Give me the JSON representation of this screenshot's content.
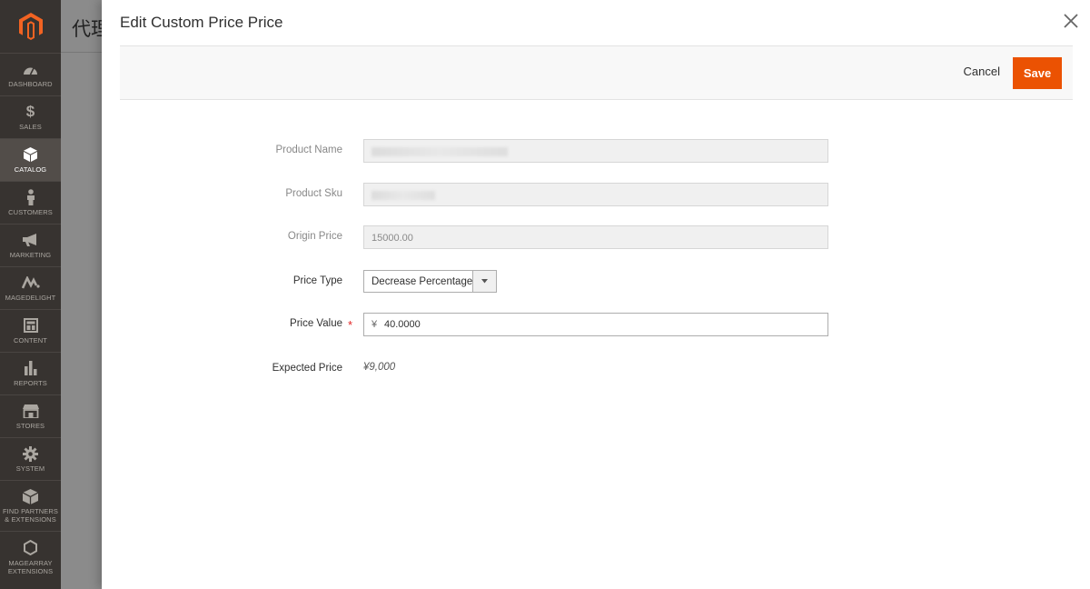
{
  "sidebar": {
    "items": [
      {
        "label": "DASHBOARD",
        "icon": "dashboard-icon"
      },
      {
        "label": "SALES",
        "icon": "dollar-icon"
      },
      {
        "label": "CATALOG",
        "icon": "box-icon",
        "active": true
      },
      {
        "label": "CUSTOMERS",
        "icon": "person-icon"
      },
      {
        "label": "MARKETING",
        "icon": "megaphone-icon"
      },
      {
        "label": "MAGEDELIGHT",
        "icon": "magedelight-icon"
      },
      {
        "label": "CONTENT",
        "icon": "layout-icon"
      },
      {
        "label": "REPORTS",
        "icon": "bar-chart-icon"
      },
      {
        "label": "STORES",
        "icon": "store-icon"
      },
      {
        "label": "SYSTEM",
        "icon": "gear-icon"
      },
      {
        "label": "FIND PARTNERS & EXTENSIONS",
        "icon": "cube-icon"
      },
      {
        "label": "MAGEARRAY EXTENSIONS",
        "icon": "hexagon-icon"
      }
    ]
  },
  "background": {
    "title": "代理"
  },
  "modal": {
    "title": "Edit Custom Price Price",
    "cancel_label": "Cancel",
    "save_label": "Save"
  },
  "form": {
    "product_name_label": "Product Name",
    "product_sku_label": "Product Sku",
    "origin_price_label": "Origin Price",
    "origin_price_value": "15000.00",
    "price_type_label": "Price Type",
    "price_type_value": "Decrease Percentage",
    "price_value_label": "Price Value",
    "currency_symbol": "¥",
    "price_value": "40.0000",
    "expected_price_label": "Expected Price",
    "expected_price_value": "¥9,000"
  },
  "colors": {
    "accent": "#eb5202",
    "sidebar_bg": "#373330",
    "required": "#e22626"
  }
}
